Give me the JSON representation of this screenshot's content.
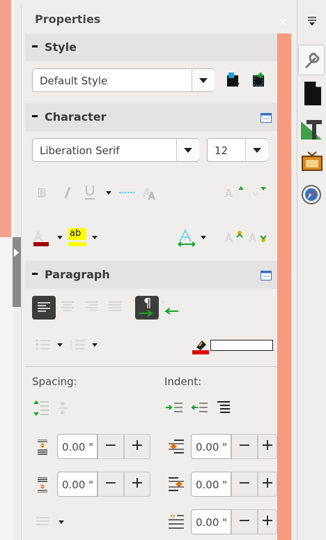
{
  "panel": {
    "title": "Properties",
    "close_glyph": "×"
  },
  "style_section": {
    "title": "Style",
    "paragraph_style": "Default Style"
  },
  "character_section": {
    "title": "Character",
    "font_name": "Liberation Serif",
    "font_size": "12",
    "highlight_label": "ab"
  },
  "paragraph_section": {
    "title": "Paragraph",
    "spacing_label": "Spacing:",
    "indent_label": "Indent:",
    "spacing_above": "0.00 \"",
    "spacing_below": "0.00 \"",
    "indent_before": "0.00 \"",
    "indent_after": "0.00 \"",
    "indent_first_line": "0.00 \"",
    "minus": "−",
    "plus": "+",
    "pilcrow": "¶"
  },
  "tabs": [
    "properties",
    "page",
    "styles",
    "gallery",
    "navigator"
  ],
  "colors": {
    "font_color": "#a00000",
    "highlight_color": "#ffff00",
    "accent_salmon": "#f79a7e",
    "ltr_green": "#00a000"
  }
}
